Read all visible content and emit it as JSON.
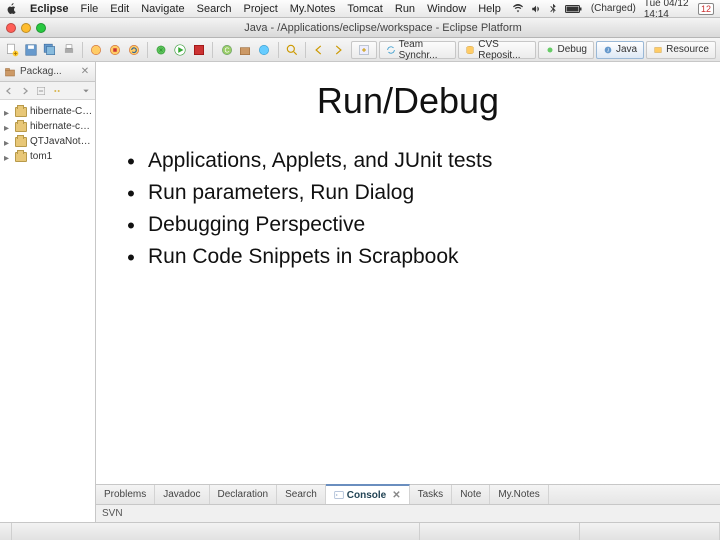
{
  "menubar": {
    "app": "Eclipse",
    "items": [
      "File",
      "Edit",
      "Navigate",
      "Search",
      "Project",
      "My.Notes",
      "Tomcat",
      "Run",
      "Window",
      "Help"
    ],
    "battery": "(Charged)",
    "clock": "Tue 04/12 14:14",
    "day": "12"
  },
  "window": {
    "title": "Java - /Applications/eclipse/workspace - Eclipse Platform"
  },
  "perspectives": [
    {
      "label": "Team Synchr...",
      "active": false
    },
    {
      "label": "CVS Reposit...",
      "active": false
    },
    {
      "label": "Debug",
      "active": false
    },
    {
      "label": "Java",
      "active": true
    },
    {
      "label": "Resource",
      "active": false
    }
  ],
  "sidebar": {
    "view_title": "Packag...",
    "projects": [
      {
        "label": "hibernate-Ch03"
      },
      {
        "label": "hibernate-ch05"
      },
      {
        "label": "QTJavaNotebook"
      },
      {
        "label": "tom1"
      }
    ]
  },
  "slide": {
    "title": "Run/Debug",
    "bullets": [
      "Applications, Applets, and JUnit tests",
      "Run parameters, Run Dialog",
      "Debugging Perspective",
      "Run Code Snippets in Scrapbook"
    ]
  },
  "bottom_tabs": [
    "Problems",
    "Javadoc",
    "Declaration",
    "Search",
    "Console",
    "Tasks",
    "Note",
    "My.Notes"
  ],
  "bottom_active": "Console",
  "svn_label": "SVN"
}
